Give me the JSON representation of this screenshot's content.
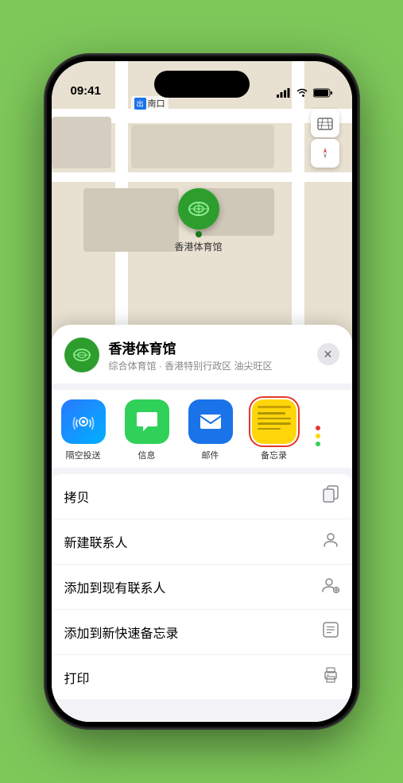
{
  "status_bar": {
    "time": "09:41",
    "location_arrow": "▶"
  },
  "map": {
    "label_nan": "南口",
    "label_nan_prefix": "出"
  },
  "map_controls": {
    "map_icon": "🗺",
    "compass_icon": "⬆"
  },
  "stadium_pin": {
    "label": "香港体育馆"
  },
  "venue_header": {
    "name": "香港体育馆",
    "subtitle": "综合体育馆 · 香港特别行政区 油尖旺区",
    "close_label": "✕"
  },
  "share_items": [
    {
      "id": "airdrop",
      "label": "隔空投送",
      "selected": false
    },
    {
      "id": "message",
      "label": "信息",
      "selected": false
    },
    {
      "id": "mail",
      "label": "邮件",
      "selected": false
    },
    {
      "id": "notes",
      "label": "备忘录",
      "selected": true
    }
  ],
  "menu_items": [
    {
      "label": "拷贝",
      "icon": "copy"
    },
    {
      "label": "新建联系人",
      "icon": "person"
    },
    {
      "label": "添加到现有联系人",
      "icon": "person-add"
    },
    {
      "label": "添加到新快速备忘录",
      "icon": "note"
    },
    {
      "label": "打印",
      "icon": "printer"
    }
  ]
}
